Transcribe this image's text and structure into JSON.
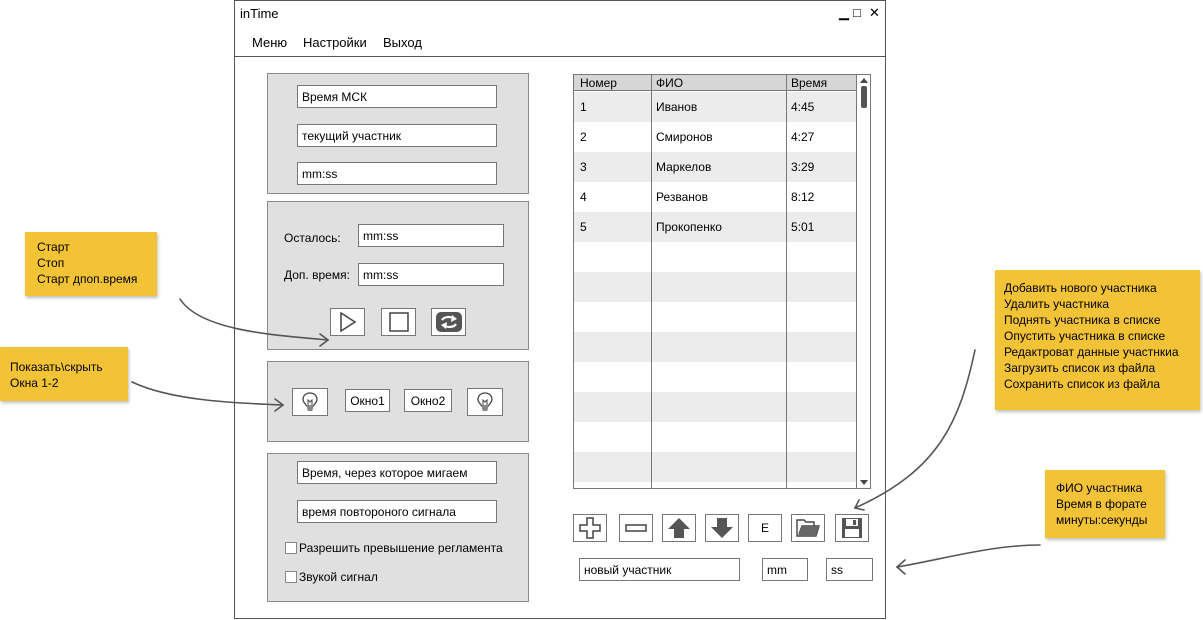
{
  "window": {
    "title": "inTime",
    "controls": [
      "▁",
      "□",
      "✕"
    ]
  },
  "menu": [
    "Меню",
    "Настройки",
    "Выход"
  ],
  "time_panel": {
    "msk_time": "Время МСК",
    "current_participant": "текущий участник",
    "time_value": "mm:ss"
  },
  "timer_panel": {
    "remaining_label": "Осталось:",
    "remaining_value": "mm:ss",
    "extra_label": "Доп. время:",
    "extra_value": "mm:ss",
    "buttons": [
      "play-icon",
      "stop-icon",
      "refresh-icon"
    ]
  },
  "windows_panel": {
    "window1": "Окно1",
    "window2": "Окно2",
    "icons": [
      "lightbulb-icon",
      "lightbulb-icon"
    ]
  },
  "signal_panel": {
    "blink_time": "Время, через которое мигаем",
    "repeat_signal": "время повтороного сигнала",
    "allow_exceed": "Разрешить превышение регламента",
    "sound_signal": "Звукой сигнал"
  },
  "table": {
    "headers": [
      "Номер",
      "ФИО",
      "Время"
    ],
    "rows": [
      [
        "1",
        "Иванов",
        "4:45"
      ],
      [
        "2",
        "Смиронов",
        "4:27"
      ],
      [
        "3",
        "Маркелов",
        "3:29"
      ],
      [
        "4",
        "Резванов",
        "8:12"
      ],
      [
        "5",
        "Прокопенко",
        "5:01"
      ]
    ]
  },
  "list_toolbar": {
    "buttons": [
      "plus-icon",
      "minus-icon",
      "arrow-up-icon",
      "arrow-down-icon",
      "E",
      "folder-icon",
      "save-icon"
    ]
  },
  "new_entry": {
    "name": "новый участник",
    "minutes": "mm",
    "seconds": "ss"
  },
  "notes": {
    "start_stop": [
      "Старт",
      "Стоп",
      "Старт дпоп.время"
    ],
    "show_hide": [
      "Показать\\скрыть",
      "Окна 1-2"
    ],
    "list_actions": [
      "Добавить нового участника",
      "Удалить участника",
      "Поднять участника в списке",
      "Опустить участника в списке",
      "Редактроват данные участнкиа",
      "Загрузить список из файла",
      "Сохранить список из файла"
    ],
    "entry_format": [
      "ФИО участника",
      "Время в форате",
      "минуты:секунды"
    ]
  },
  "colors": {
    "note": "#f2c237",
    "panel": "#e0e0e0",
    "icon_dark": "#555555"
  }
}
